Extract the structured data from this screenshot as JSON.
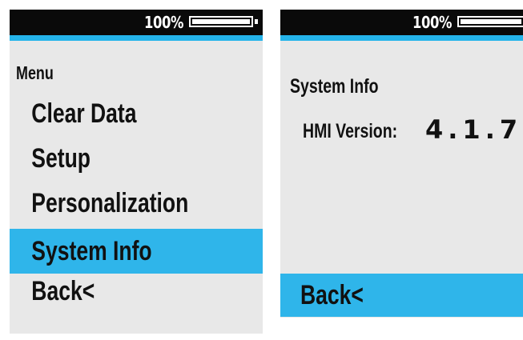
{
  "colors": {
    "screen_bg": "#e8e8e8",
    "status_bar": "#0a0a0a",
    "accent": "#2fb5ea"
  },
  "left_screen": {
    "battery": {
      "label": "100%",
      "level": 1.0
    },
    "menu": {
      "heading": "Menu",
      "items": [
        {
          "label": "Clear Data",
          "selected": false
        },
        {
          "label": "Setup",
          "selected": false
        },
        {
          "label": "Personalization",
          "selected": false
        },
        {
          "label": "System Info",
          "selected": true
        },
        {
          "label": "Back<",
          "selected": false
        }
      ]
    }
  },
  "right_screen": {
    "battery": {
      "label": "100%",
      "level": 1.0
    },
    "system_info": {
      "title": "System Info",
      "hmi_label": "HMI Version:",
      "hmi_value": "4.1.7"
    },
    "back_label": "Back<"
  }
}
